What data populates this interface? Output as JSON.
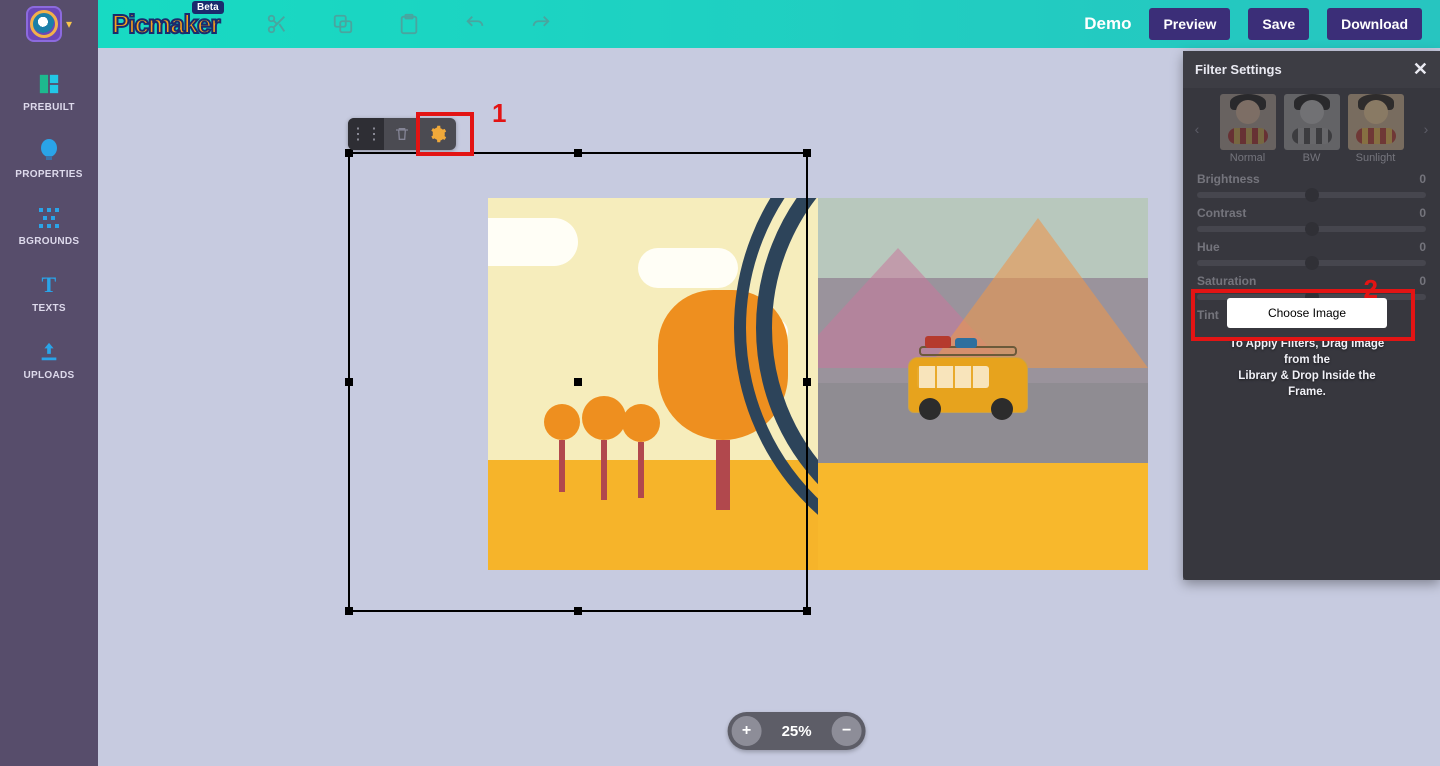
{
  "header": {
    "logo_text": "Picmaker",
    "beta": "Beta",
    "demo": "Demo",
    "preview": "Preview",
    "save": "Save",
    "download": "Download"
  },
  "sidebar": {
    "items": [
      {
        "label": "PREBUILT",
        "icon": "grid-icon"
      },
      {
        "label": "PROPERTIES",
        "icon": "bulb-icon"
      },
      {
        "label": "BGROUNDS",
        "icon": "pattern-icon"
      },
      {
        "label": "TEXTS",
        "icon": "text-icon"
      },
      {
        "label": "UPLOADS",
        "icon": "upload-icon"
      }
    ]
  },
  "callouts": {
    "one": "1",
    "two": "2"
  },
  "zoom": {
    "value": "25%"
  },
  "filters": {
    "title": "Filter Settings",
    "presets": [
      {
        "label": "Normal",
        "variant": "normal"
      },
      {
        "label": "BW",
        "variant": "bw"
      },
      {
        "label": "Sunlight",
        "variant": "sun"
      }
    ],
    "sliders": [
      {
        "name": "Brightness",
        "value": "0"
      },
      {
        "name": "Contrast",
        "value": "0"
      },
      {
        "name": "Hue",
        "value": "0"
      },
      {
        "name": "Saturation",
        "value": "0"
      },
      {
        "name": "Tint",
        "value": ""
      }
    ],
    "choose_label": "Choose Image",
    "hint_line1": "To Apply Filters, Drag Image from the",
    "hint_line2": "Library & Drop Inside the Frame."
  }
}
